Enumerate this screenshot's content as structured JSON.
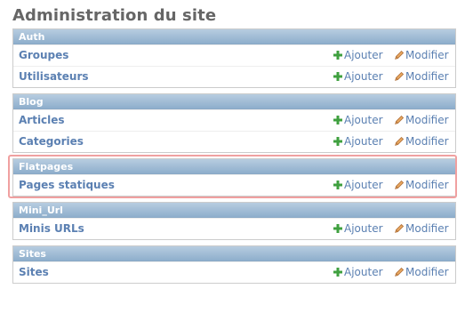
{
  "page": {
    "title": "Administration du site"
  },
  "actions": {
    "add_label": "Ajouter",
    "change_label": "Modifier"
  },
  "modules": {
    "auth": {
      "caption": "Auth",
      "rows": [
        {
          "label": "Groupes"
        },
        {
          "label": "Utilisateurs"
        }
      ]
    },
    "blog": {
      "caption": "Blog",
      "rows": [
        {
          "label": "Articles"
        },
        {
          "label": "Categories"
        }
      ]
    },
    "flatpages": {
      "caption": "Flatpages",
      "highlighted": true,
      "rows": [
        {
          "label": "Pages statiques"
        }
      ]
    },
    "mini_url": {
      "caption": "Mini_Url",
      "rows": [
        {
          "label": "Minis URLs"
        }
      ]
    },
    "sites": {
      "caption": "Sites",
      "rows": [
        {
          "label": "Sites"
        }
      ]
    }
  },
  "colors": {
    "link": "#5b80b2",
    "caption_bg": "#a1bdd8",
    "title": "#666666",
    "add_icon": "#3fa03f",
    "change_icon": "#c07030",
    "highlight_border": "#f0a0a0"
  },
  "icons": {
    "add": "plus-icon",
    "change": "pencil-icon"
  }
}
